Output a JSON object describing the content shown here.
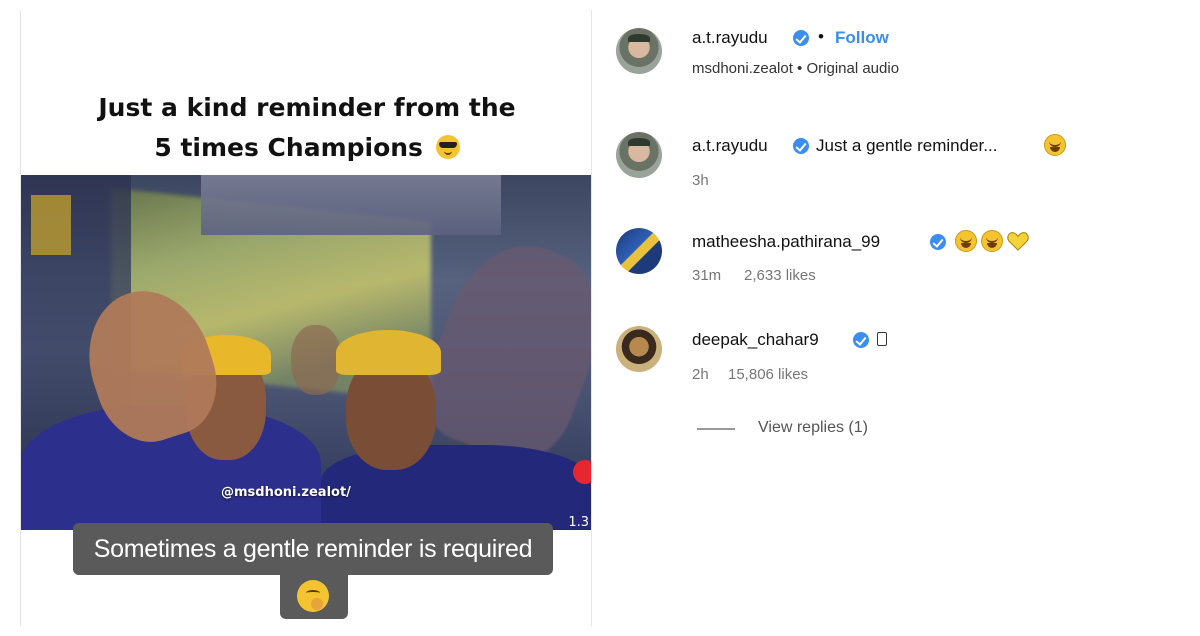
{
  "post": {
    "headline_line1": "Just a kind reminder from the",
    "headline_line2": "5 times Champions",
    "headline_emoji": "sunglasses-face",
    "watermark": "@msdhoni.zealot/",
    "like_count_partial": "1.3",
    "caption": "Sometimes a gentle reminder is required",
    "caption_emoji": "shushing-face"
  },
  "author": {
    "username": "a.t.rayudu",
    "separator": "•",
    "follow_label": "Follow",
    "audio_line": "msdhoni.zealot • Original audio"
  },
  "comments": [
    {
      "username": "a.t.rayudu",
      "text": "Just a gentle reminder...",
      "emojis": [
        "laughing-tears-face"
      ],
      "time": "3h",
      "likes": ""
    },
    {
      "username": "matheesha.pathirana_99",
      "text": "",
      "emojis": [
        "laughing-tears-face",
        "laughing-tears-face",
        "yellow-heart"
      ],
      "time": "31m",
      "likes": "2,633 likes"
    },
    {
      "username": "deepak_chahar9",
      "text": "",
      "emojis": [
        "unknown-glyph"
      ],
      "time": "2h",
      "likes": "15,806 likes"
    }
  ],
  "view_replies": "View replies (1)",
  "colors": {
    "link_blue": "#3b8ef0",
    "caption_bg": "#5a5a5a",
    "team_blue": "#2c2f8c",
    "team_yellow": "#e8b72a"
  }
}
